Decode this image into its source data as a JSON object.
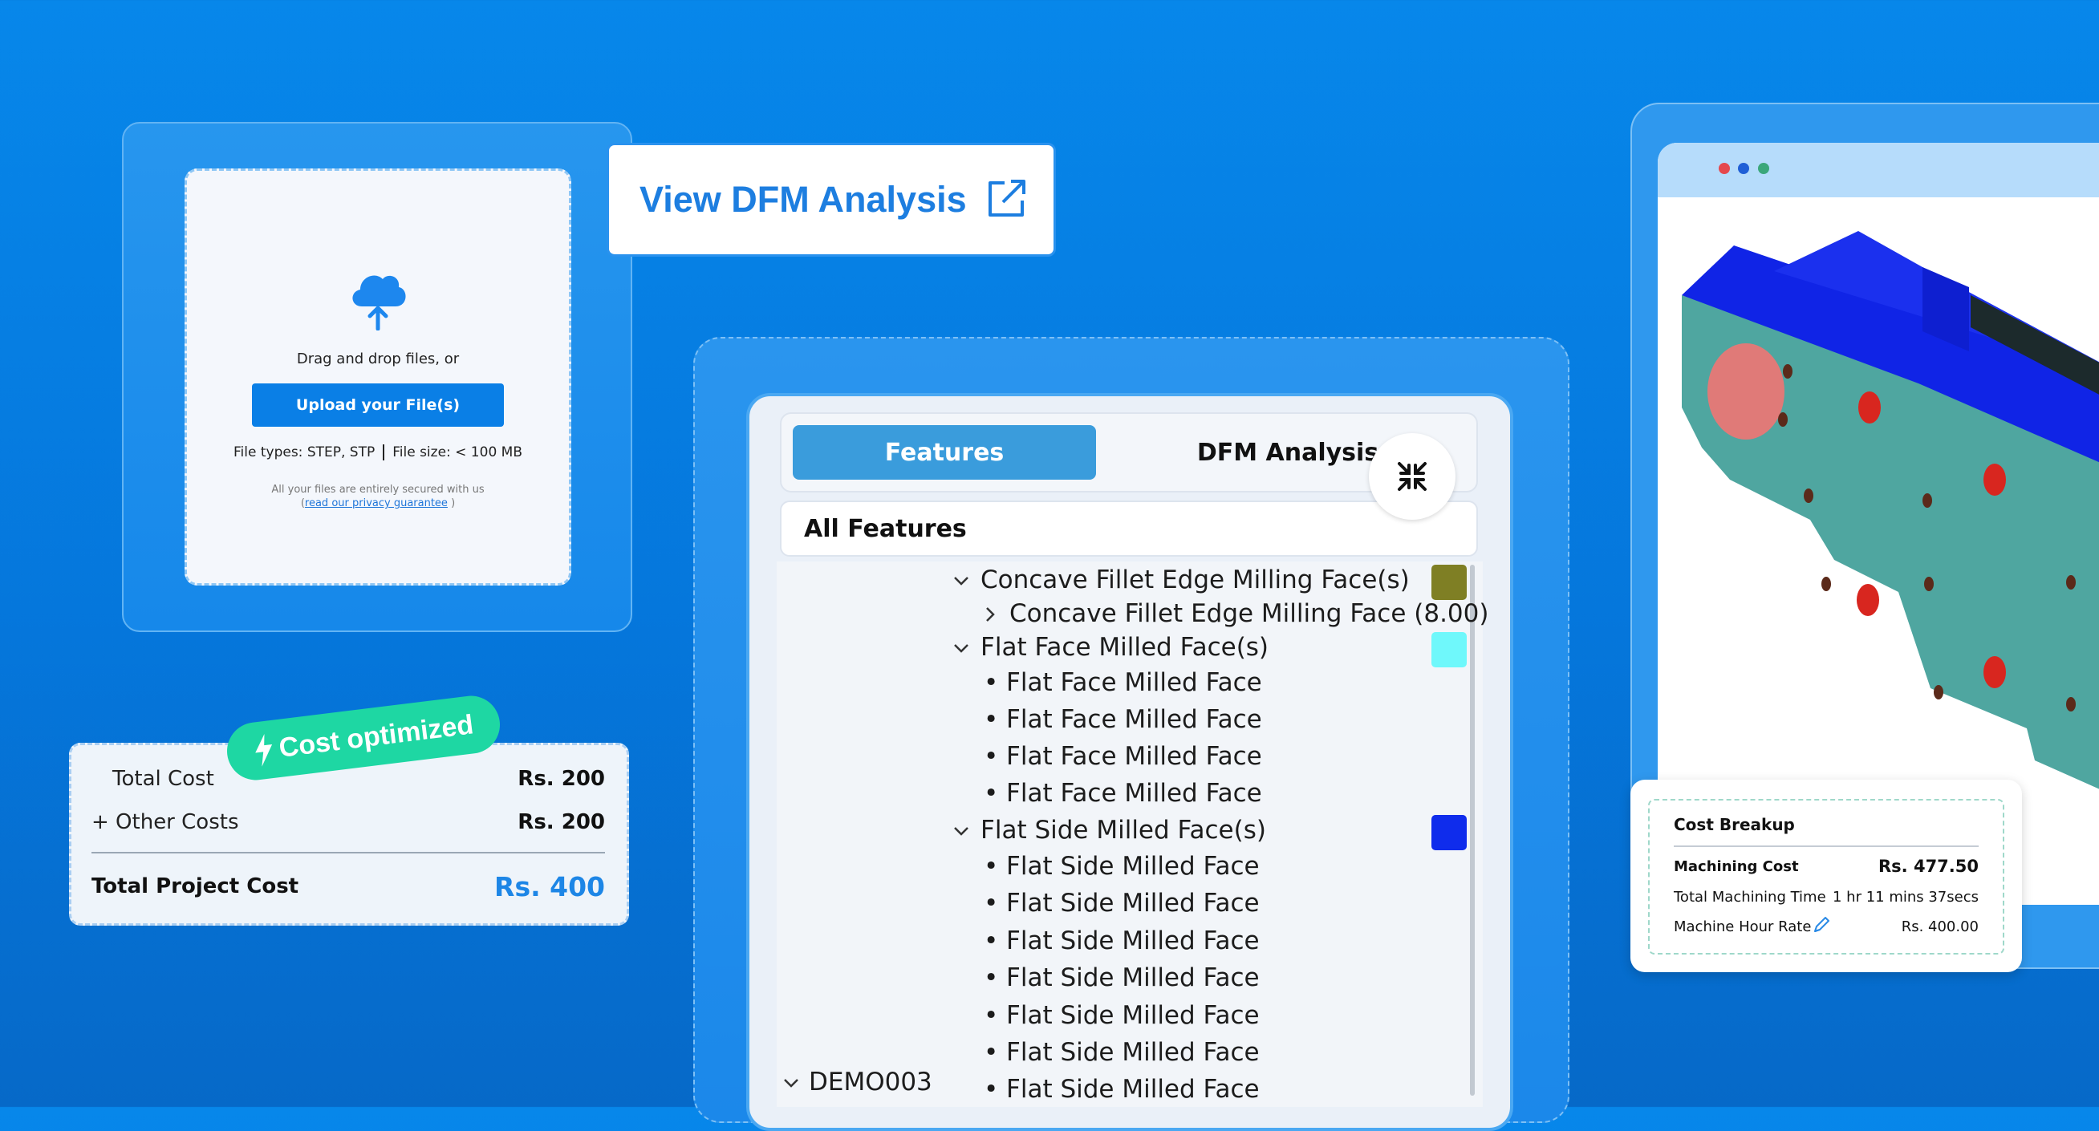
{
  "upload": {
    "drag_text": "Drag and drop files, or",
    "button_label": "Upload your File(s)",
    "file_types": "File types: STEP, STP",
    "file_size": "File size: < 100 MB",
    "secure_note": "All your files are entirely secured with us",
    "privacy_link": "read our privacy guarantee"
  },
  "dfm_button": {
    "label": "View DFM Analysis"
  },
  "cost": {
    "badge": "Cost optimized",
    "rows": [
      {
        "label": "Total Cost",
        "value": "Rs. 200"
      },
      {
        "label": "+ Other Costs",
        "value": "Rs. 200"
      }
    ],
    "total_label": "Total Project Cost",
    "total_value": "Rs. 400"
  },
  "features_panel": {
    "tabs": [
      {
        "label": "Features",
        "active": true
      },
      {
        "label": "DFM Analysis",
        "active": false
      }
    ],
    "all_features_label": "All Features",
    "tree": {
      "g1": "Concave Fillet Edge Milling Face(s)",
      "g1_child": "Concave Fillet Edge Milling Face (8.00)",
      "g2": "Flat Face Milled Face(s)",
      "g2_item": "Flat Face Milled Face",
      "g3": "Flat Side Milled Face(s)",
      "g3_item": "Flat Side Milled Face",
      "part": "DEMO003"
    },
    "swatch_colors": {
      "g1": "#7f7f24",
      "g2": "#6ff8fb",
      "g3": "#0f2cec"
    }
  },
  "cost_breakup": {
    "title": "Cost Breakup",
    "machining_cost_label": "Machining Cost",
    "machining_cost_value": "Rs. 477.50",
    "time_label": "Total Machining Time",
    "time_value": "1 hr 11 mins 37secs",
    "rate_label": "Machine Hour Rate",
    "rate_value": "Rs. 400.00"
  },
  "window_dots": {
    "red": "#e5484d",
    "blue": "#1f5fd6",
    "green": "#3ba77a"
  }
}
